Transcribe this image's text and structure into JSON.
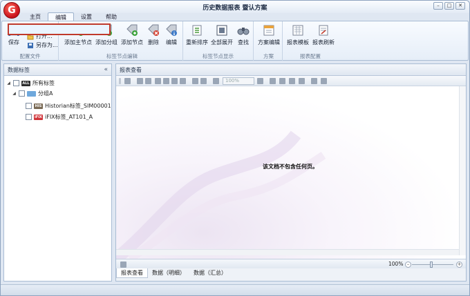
{
  "window": {
    "title": "历史数据报表 暨认方案",
    "logo_text": "G",
    "controls": {
      "minimize": "–",
      "maximize": "□",
      "close": "✕"
    }
  },
  "ribbon": {
    "tabs": [
      "主页",
      "编辑",
      "设置",
      "帮助"
    ],
    "active_tab": "编辑",
    "groups": {
      "config_file": {
        "label": "配置文件",
        "save": "保存",
        "new": "新建",
        "open": "打开...",
        "save_as": "另存为..."
      },
      "tag_node_edit": {
        "label": "标签节点编辑",
        "add_main_node": "添加主节点",
        "add_group": "添加分组",
        "add_node": "添加节点",
        "delete": "删除",
        "edit": "编辑"
      },
      "tag_node_display": {
        "label": "标签节点显示",
        "resort": "重新排序",
        "expand_all": "全部展开",
        "find": "查找"
      },
      "scheme": {
        "label": "方案",
        "scheme_edit": "方案编辑"
      },
      "report_config": {
        "label": "报表配置",
        "report_template": "报表模板",
        "report_refresh": "报表刷新"
      }
    }
  },
  "left_panel": {
    "title": "数据标签",
    "collapse_glyph": "«",
    "tree": [
      {
        "label": "所有标签",
        "level": 0,
        "icon_text": "ALL"
      },
      {
        "label": "分组A",
        "level": 1,
        "icon_text": ""
      },
      {
        "label": "Historian标签_SIM00001",
        "level": 2,
        "icon_text": "HIS"
      },
      {
        "label": "iFIX标签_AT101_A",
        "level": 2,
        "icon_text": "iFIX"
      }
    ]
  },
  "right_panel": {
    "title": "报表查看",
    "zoom_combo": "100%",
    "empty_message": "该文档不包含任何页。",
    "zoom_percent": "100%",
    "bottom_tabs": [
      "报表查看",
      "数据（明细）",
      "数据（汇总）"
    ],
    "active_bottom_tab": "报表查看"
  },
  "colors": {
    "accent": "#c0392b",
    "ribbon_bg": "#eef3fa"
  }
}
